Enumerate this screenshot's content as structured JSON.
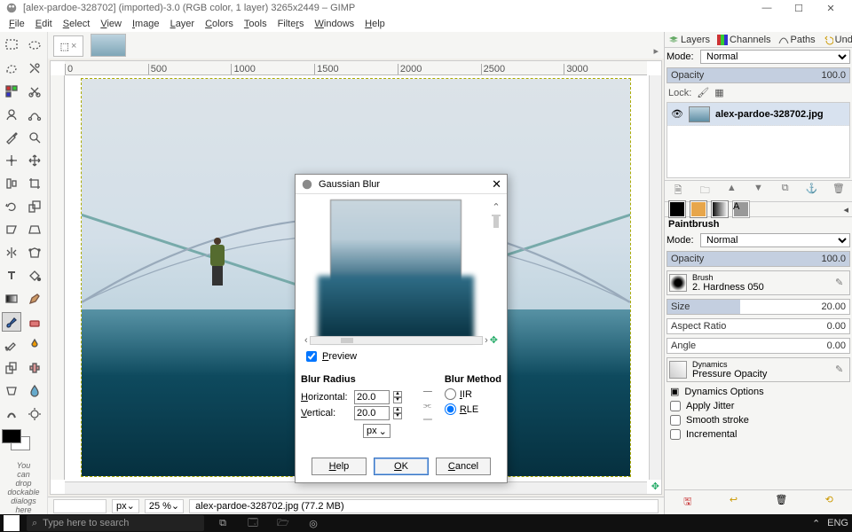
{
  "title": "[alex-pardoe-328702] (imported)-3.0 (RGB color, 1 layer) 3265x2449 – GIMP",
  "menu": {
    "file": "File",
    "edit": "Edit",
    "select": "Select",
    "view": "View",
    "image": "Image",
    "layer": "Layer",
    "colors": "Colors",
    "tools": "Tools",
    "filters": "Filters",
    "windows": "Windows",
    "help": "Help"
  },
  "ruler_ticks": [
    "0",
    "500",
    "1000",
    "1500",
    "2000",
    "2500",
    "3000"
  ],
  "toolbox_hint": "You\ncan\ndrop\ndockable\ndialogs\nhere",
  "statusbar": {
    "unit": "px",
    "zoom": "25 %",
    "status": "alex-pardoe-328702.jpg (77.2 MB)"
  },
  "layers": {
    "tabs": {
      "layers": "Layers",
      "channels": "Channels",
      "paths": "Paths",
      "undo": "Undo"
    },
    "mode_label": "Mode:",
    "mode": "Normal",
    "opacity_label": "Opacity",
    "opacity": "100.0",
    "lock_label": "Lock:",
    "item": "alex-pardoe-328702.jpg"
  },
  "brush": {
    "title": "Paintbrush",
    "mode_label": "Mode:",
    "mode": "Normal",
    "opacity_label": "Opacity",
    "opacity": "100.0",
    "brush_label": "Brush",
    "brush": "2. Hardness 050",
    "size_label": "Size",
    "size": "20.00",
    "ar_label": "Aspect Ratio",
    "ar": "0.00",
    "angle_label": "Angle",
    "angle": "0.00",
    "dyn_label": "Dynamics",
    "dyn": "Pressure Opacity",
    "dyn_opts": "Dynamics Options",
    "jitter": "Apply Jitter",
    "smooth": "Smooth stroke",
    "incremental": "Incremental"
  },
  "dialog": {
    "title": "Gaussian Blur",
    "preview": "Preview",
    "radius_label": "Blur Radius",
    "h_label": "Horizontal:",
    "h": "20.0",
    "v_label": "Vertical:",
    "v": "20.0",
    "unit": "px",
    "method_label": "Blur Method",
    "iir": "IIR",
    "rle": "RLE",
    "help": "Help",
    "ok": "OK",
    "cancel": "Cancel"
  },
  "taskbar": {
    "search": "Type here to search",
    "lang": "ENG"
  }
}
